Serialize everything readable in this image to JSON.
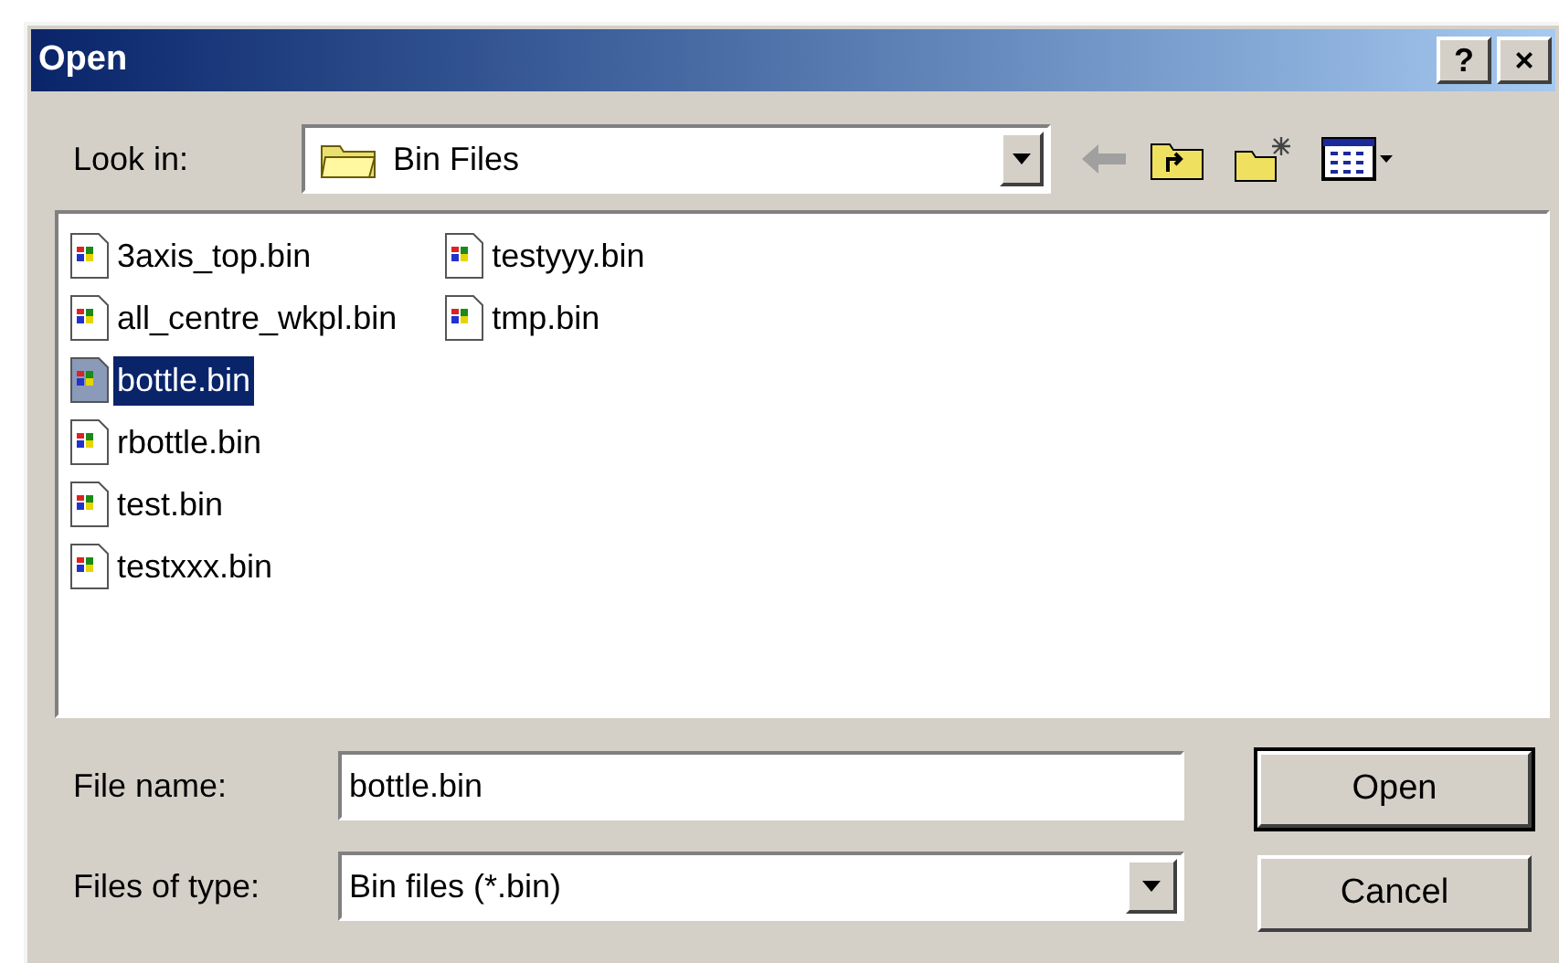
{
  "window": {
    "title": "Open",
    "title_buttons": [
      "?",
      "×"
    ]
  },
  "look_in": {
    "label": "Look in:",
    "value": "Bin Files"
  },
  "files": [
    {
      "name": "3axis_top.bin",
      "selected": false
    },
    {
      "name": "all_centre_wkpl.bin",
      "selected": false
    },
    {
      "name": "bottle.bin",
      "selected": true
    },
    {
      "name": "rbottle.bin",
      "selected": false
    },
    {
      "name": "test.bin",
      "selected": false
    },
    {
      "name": "testxxx.bin",
      "selected": false
    },
    {
      "name": "testyyy.bin",
      "selected": false
    },
    {
      "name": "tmp.bin",
      "selected": false
    }
  ],
  "file_name": {
    "label": "File name:",
    "value": "bottle.bin"
  },
  "file_type": {
    "label": "Files of type:",
    "value": "Bin files (*.bin)"
  },
  "buttons": [
    {
      "label": "Open",
      "default": true
    },
    {
      "label": "Cancel",
      "default": false
    }
  ]
}
